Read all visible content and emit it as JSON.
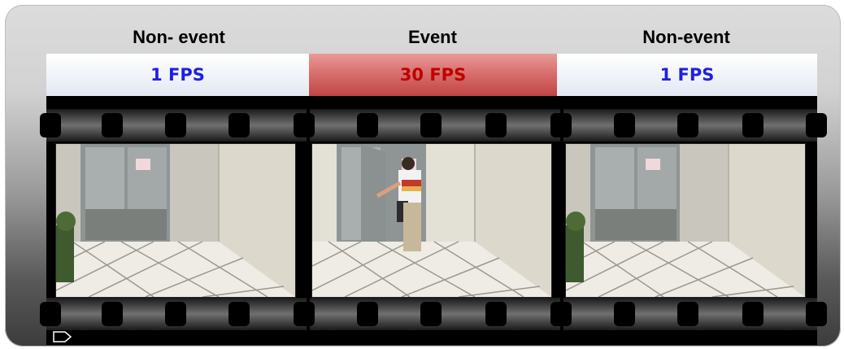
{
  "segments": [
    {
      "heading": "Non- event",
      "fps": "1 FPS",
      "type": "normal",
      "fps_color": "#1f1fe0"
    },
    {
      "heading": "Event",
      "fps": "30 FPS",
      "type": "event",
      "fps_color": "#c00000"
    },
    {
      "heading": "Non-event",
      "fps": "1 FPS",
      "type": "normal",
      "fps_color": "#1f1fe0"
    }
  ],
  "icons": {
    "play": "play-outline-icon"
  },
  "colors": {
    "event_band": "#d8706e",
    "normal_band": "#eef2f8",
    "film": "#000000"
  }
}
